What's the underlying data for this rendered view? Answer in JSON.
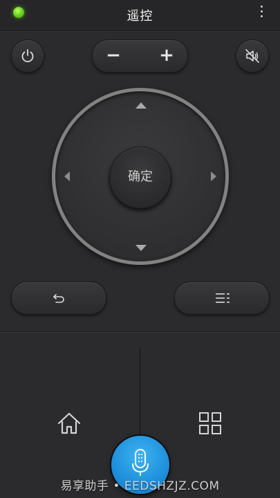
{
  "header": {
    "title": "遥控"
  },
  "volume": {
    "minus_label": "−",
    "plus_label": "+"
  },
  "dpad": {
    "ok_label": "确定"
  },
  "icons": {
    "status": "status-led",
    "power": "power-icon",
    "mute": "mute-icon",
    "back": "back-icon",
    "menu": "menu-icon",
    "home": "home-icon",
    "apps": "apps-grid-icon",
    "mic": "microphone-icon",
    "more": "more-vertical-icon"
  },
  "colors": {
    "status_led": "#6fd61f",
    "mic_accent": "#1e8fdb",
    "background": "#2b2b2d"
  },
  "watermark": {
    "text": "易享助手 • EEDSHZJZ.COM"
  }
}
